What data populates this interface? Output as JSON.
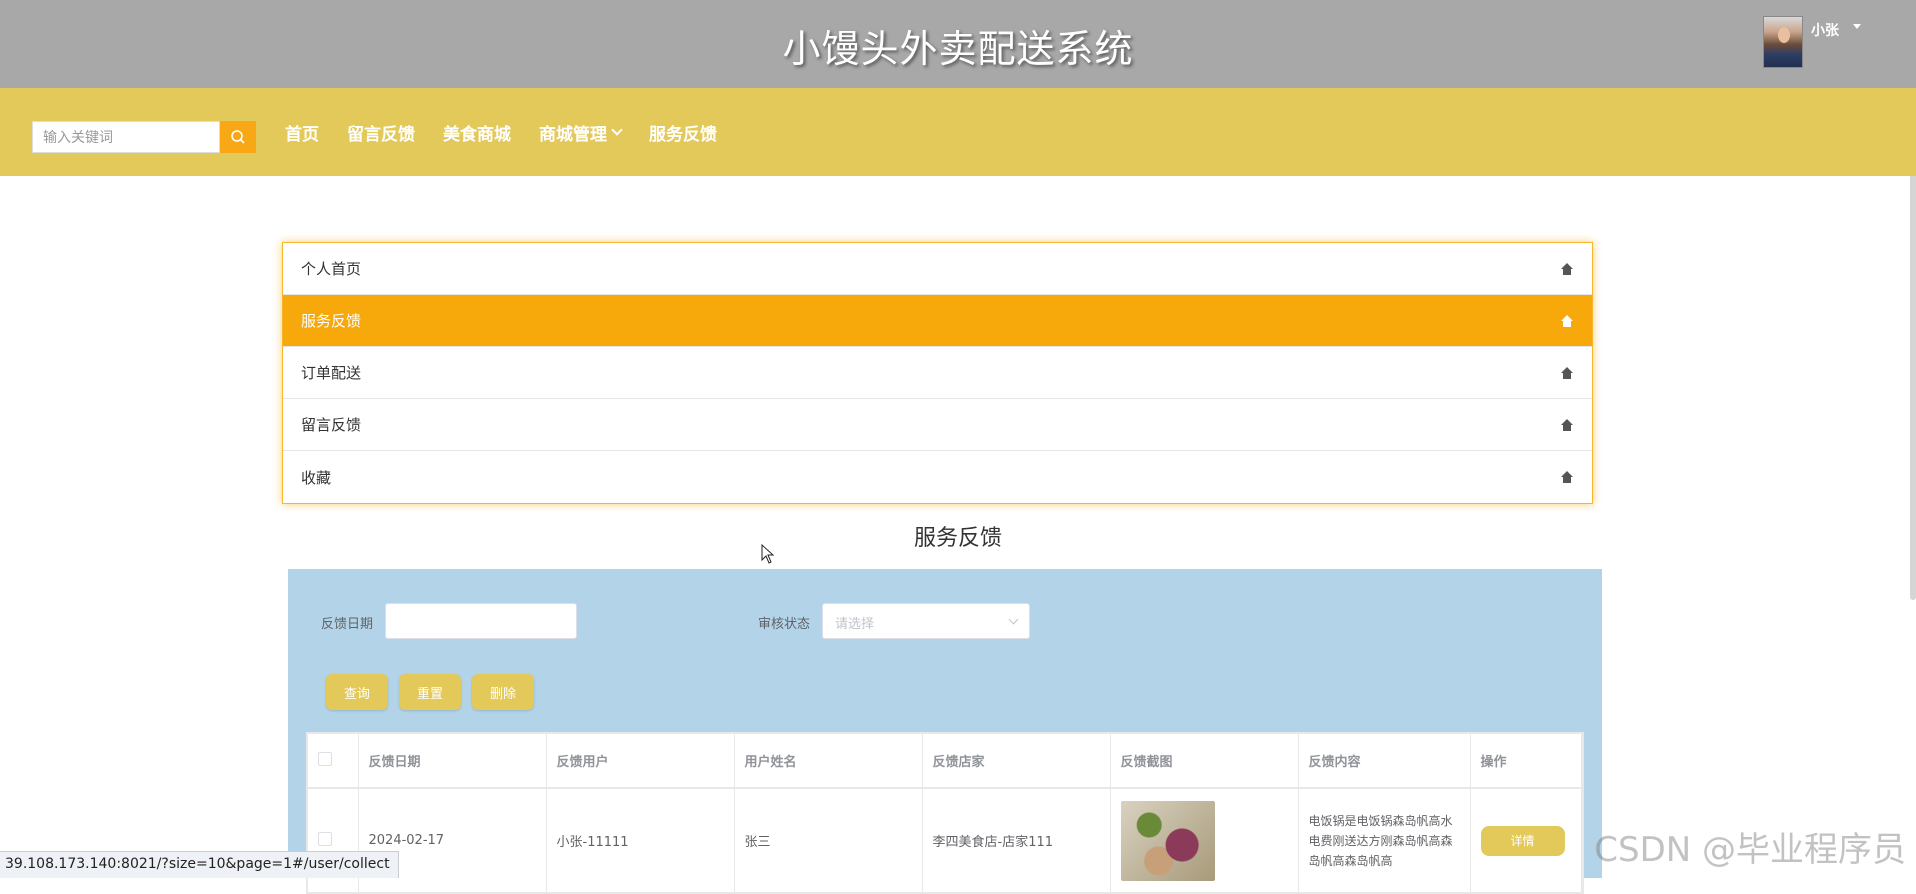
{
  "header": {
    "title": "小馒头外卖配送系统",
    "username": "小张"
  },
  "nav": {
    "search_placeholder": "输入关键词",
    "links": [
      {
        "label": "首页"
      },
      {
        "label": "留言反馈"
      },
      {
        "label": "美食商城"
      },
      {
        "label": "商城管理"
      },
      {
        "label": "服务反馈"
      }
    ]
  },
  "side_menu": {
    "items": [
      {
        "label": "个人首页",
        "active": false
      },
      {
        "label": "服务反馈",
        "active": true
      },
      {
        "label": "订单配送",
        "active": false
      },
      {
        "label": "留言反馈",
        "active": false
      },
      {
        "label": "收藏",
        "active": false
      }
    ]
  },
  "section_title": "服务反馈",
  "filters": {
    "date_label": "反馈日期",
    "date_value": "",
    "status_label": "审核状态",
    "status_placeholder": "请选择"
  },
  "buttons": {
    "query": "查询",
    "reset": "重置",
    "delete": "删除"
  },
  "table": {
    "headers": [
      "反馈日期",
      "反馈用户",
      "用户姓名",
      "反馈店家",
      "反馈截图",
      "反馈内容",
      "操作"
    ],
    "rows": [
      {
        "date": "2024-02-17",
        "user": "小张-11111",
        "name": "张三",
        "shop": "李四美食店-店家111",
        "content": "电饭锅是电饭锅森岛帆高水电费刚送达方刚森岛帆高森岛帆高森岛帆高",
        "action": "详情"
      }
    ]
  },
  "status_bar": "39.108.173.140:8021/?size=10&page=1#/user/collect",
  "watermark": "CSDN @毕业程序员",
  "colors": {
    "topbar": "#a8a8a8",
    "navbar": "#e3c95a",
    "accent": "#f7a80a",
    "panel": "#b3d4e8"
  }
}
